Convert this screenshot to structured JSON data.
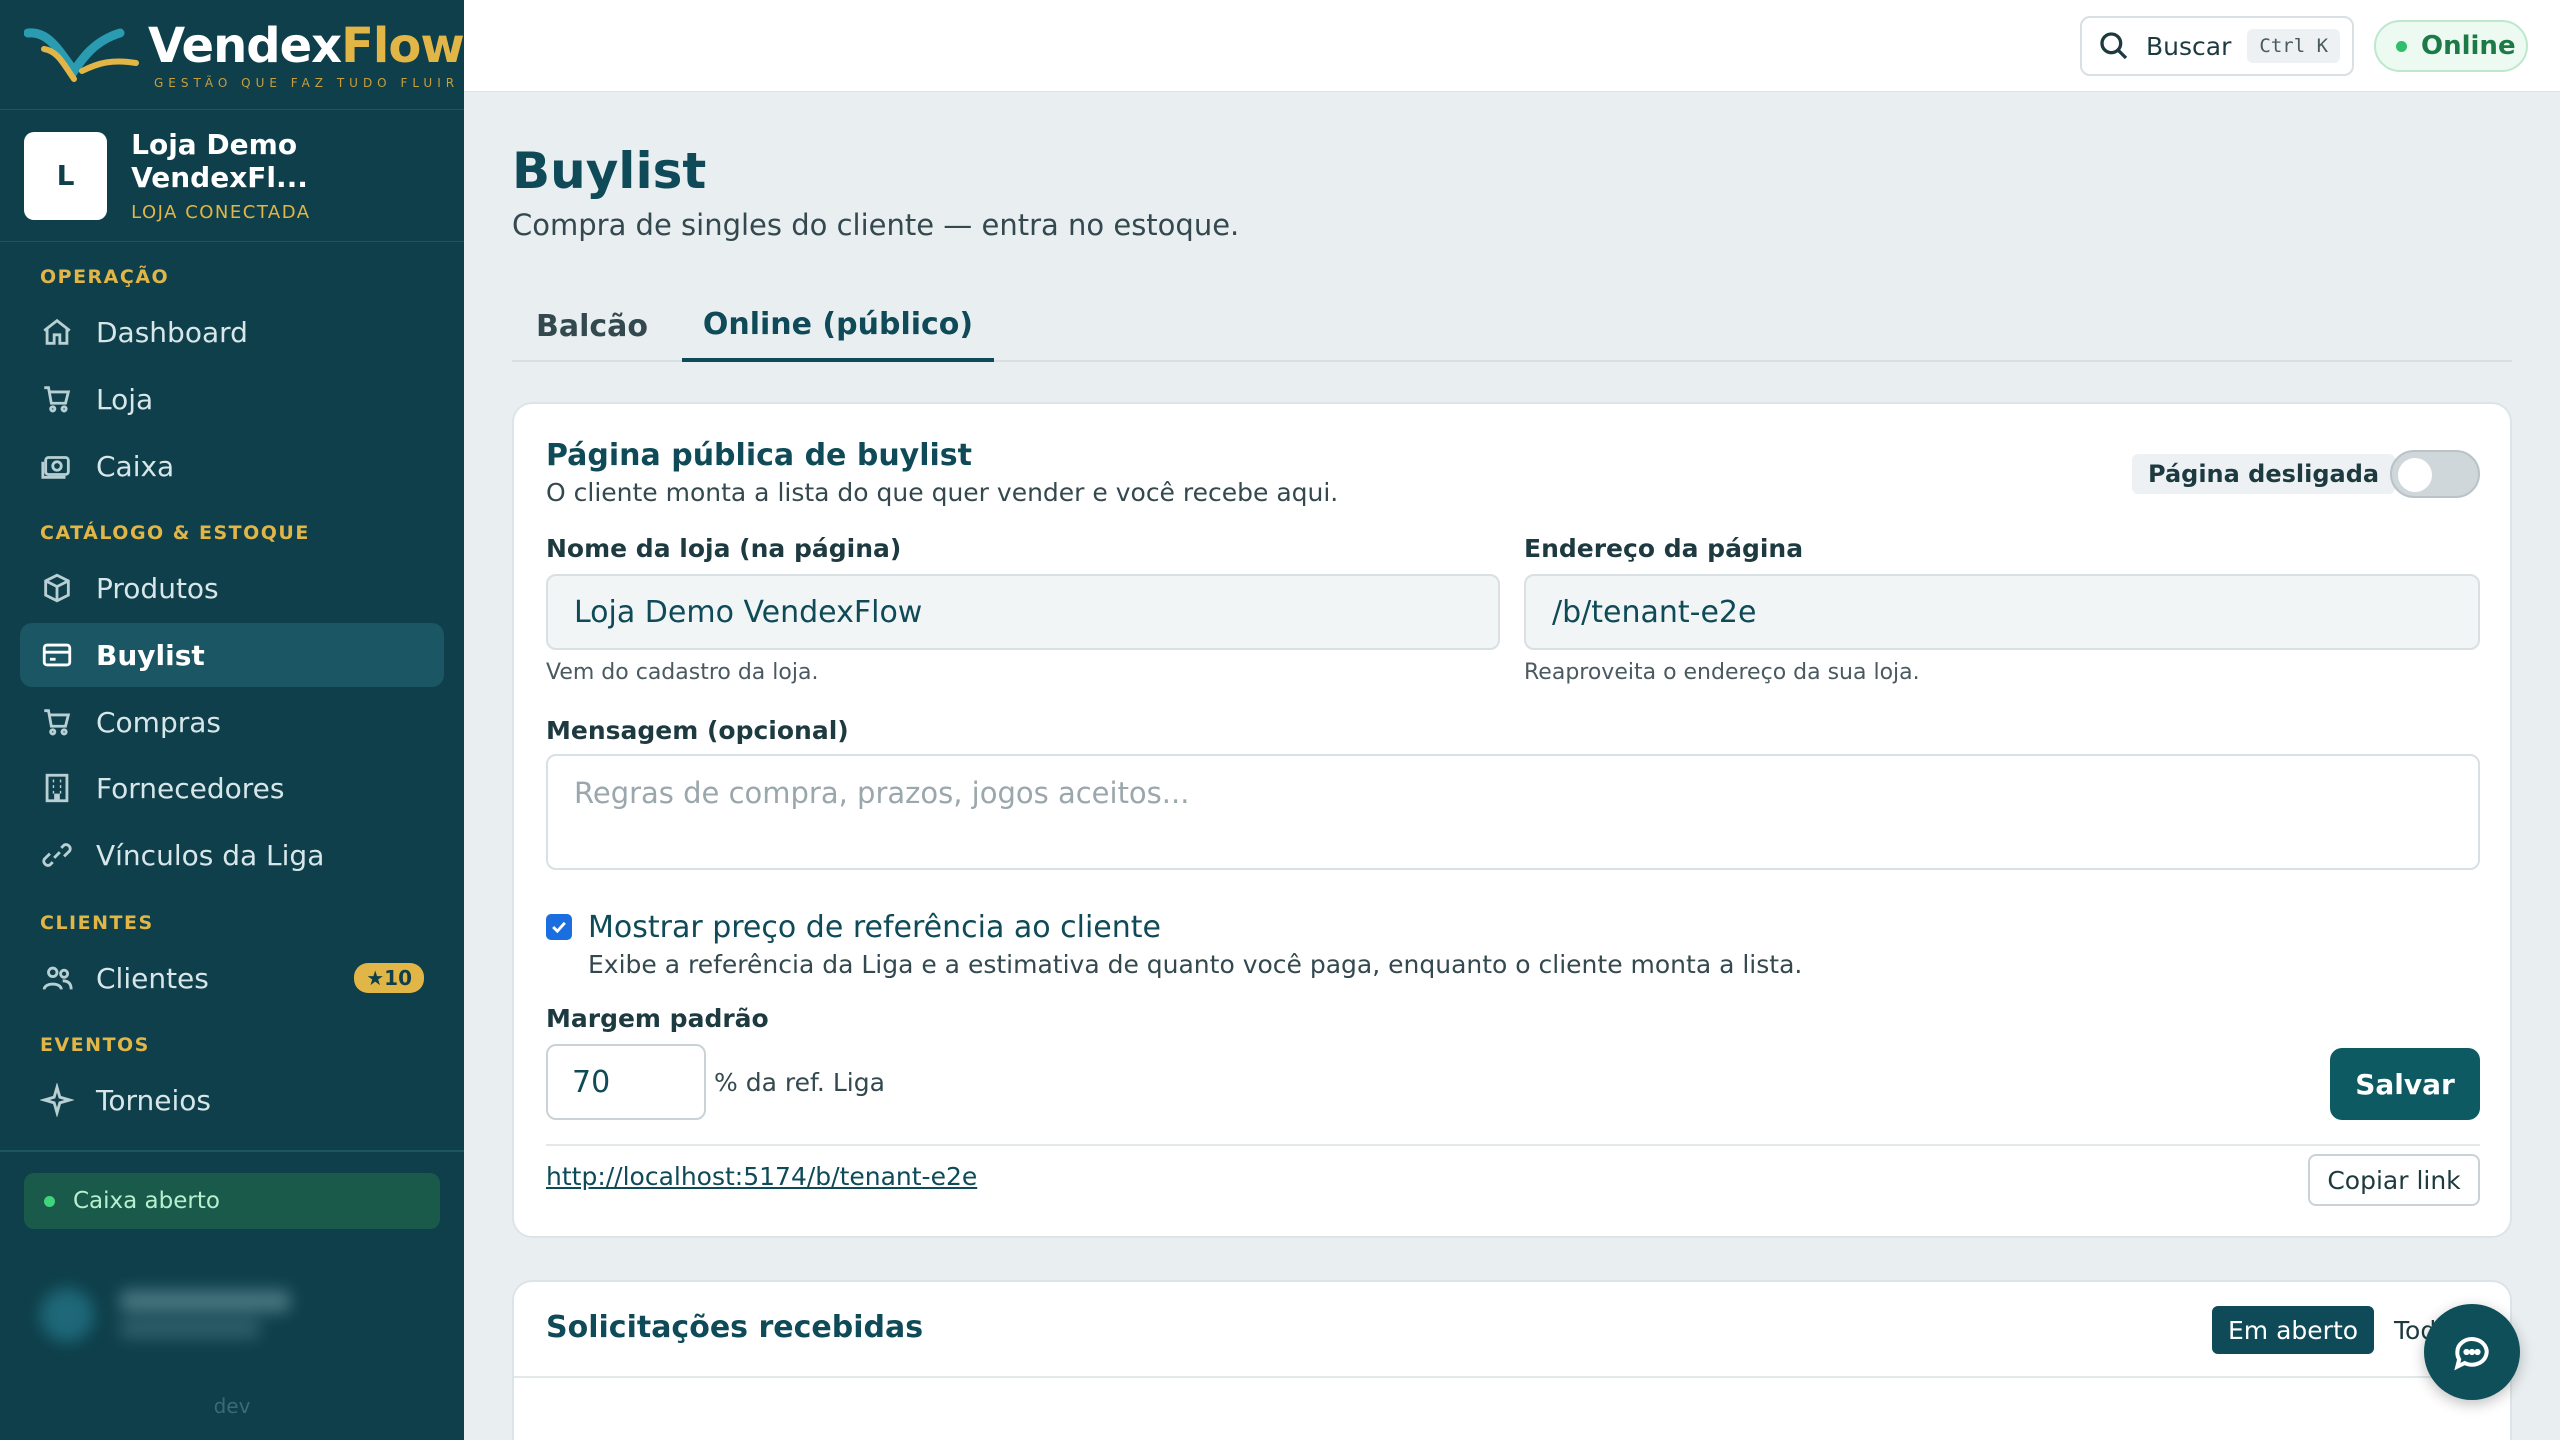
{
  "brand": {
    "name_a": "Vendex",
    "name_b": "Flow",
    "tagline": "GESTÃO QUE FAZ TUDO FLUIR"
  },
  "store": {
    "initial": "L",
    "name": "Loja Demo VendexFl...",
    "status": "LOJA CONECTADA"
  },
  "sidebar": {
    "sections": {
      "operacao": "OPERAÇÃO",
      "catalogo": "CATÁLOGO & ESTOQUE",
      "clientes": "CLIENTES",
      "eventos": "EVENTOS"
    },
    "items": [
      {
        "label": "Dashboard",
        "icon": "home-icon"
      },
      {
        "label": "Loja",
        "icon": "cart-icon"
      },
      {
        "label": "Caixa",
        "icon": "cash-icon"
      },
      {
        "label": "Produtos",
        "icon": "box-icon"
      },
      {
        "label": "Buylist",
        "icon": "card-icon",
        "active": true
      },
      {
        "label": "Compras",
        "icon": "cart-icon"
      },
      {
        "label": "Fornecedores",
        "icon": "building-icon"
      },
      {
        "label": "Vínculos da Liga",
        "icon": "link-icon"
      },
      {
        "label": "Clientes",
        "icon": "users-icon",
        "badge": "★10"
      },
      {
        "label": "Torneios",
        "icon": "sparkle-icon"
      }
    ],
    "cash_status": "Caixa aberto",
    "env": "dev"
  },
  "topbar": {
    "search_label": "Buscar",
    "shortcut": "Ctrl K",
    "status": "Online"
  },
  "page": {
    "title": "Buylist",
    "subtitle": "Compra de singles do cliente — entra no estoque.",
    "tabs": [
      {
        "label": "Balcão"
      },
      {
        "label": "Online (público)",
        "active": true
      }
    ]
  },
  "public_page": {
    "title": "Página pública de buylist",
    "description": "O cliente monta a lista do que quer vender e você recebe aqui.",
    "toggle_label": "Página desligada",
    "toggle_on": false,
    "store_name_label": "Nome da loja (na página)",
    "store_name_value": "Loja Demo VendexFlow",
    "store_name_hint": "Vem do cadastro da loja.",
    "address_label": "Endereço da página",
    "address_value": "/b/tenant-e2e",
    "address_hint": "Reaproveita o endereço da sua loja.",
    "message_label": "Mensagem (opcional)",
    "message_placeholder": "Regras de compra, prazos, jogos aceitos...",
    "show_price_label": "Mostrar preço de referência ao cliente",
    "show_price_desc": "Exibe a referência da Liga e a estimativa de quanto você paga, enquanto o cliente monta a lista.",
    "show_price_checked": true,
    "margin_label": "Margem padrão",
    "margin_value": "70",
    "margin_suffix": "% da ref. Liga",
    "save_label": "Salvar",
    "public_link": "http://localhost:5174/b/tenant-e2e",
    "copy_label": "Copiar link"
  },
  "requests": {
    "title": "Solicitações recebidas",
    "filter_open": "Em aberto",
    "filter_all": "Tod"
  },
  "colors": {
    "sidebar": "#0e3f4a",
    "accent": "#e2b646",
    "primary": "#0e5a62",
    "online": "#2fbf6a"
  }
}
